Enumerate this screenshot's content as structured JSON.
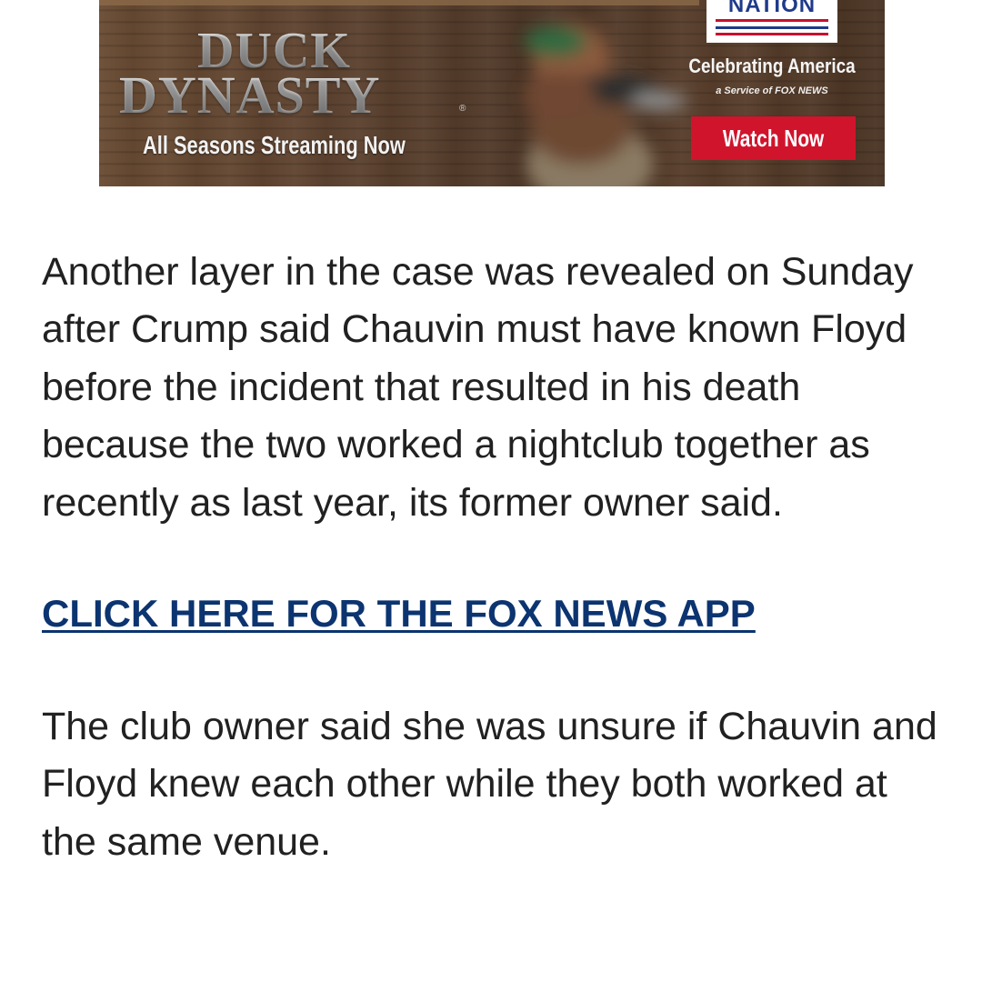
{
  "ad": {
    "title_line1": "DUCK",
    "title_line2": "DYNASTY",
    "trademark": "®",
    "tagline": "All Seasons Streaming Now",
    "logo_text": "NATION",
    "celebrating": "Celebrating America",
    "service": "a Service of FOX NEWS",
    "watch_button": "Watch Now",
    "colors": {
      "button": "#d0142c",
      "logo_blue": "#1f3a8a",
      "wood": "#5e4330"
    },
    "icons": {
      "figure": "blurred-duck-photo"
    }
  },
  "article": {
    "paragraph1": "Another layer in the case was revealed on Sunday after Crump said Chauvin must have known Floyd before the incident that resulted in his death because the two worked a nightclub together as recently as last year, its former owner said.",
    "app_link": "CLICK HERE FOR THE FOX NEWS APP",
    "paragraph2": "The club owner said she was unsure if Chauvin and Floyd knew each other while they both worked at the same venue.",
    "colors": {
      "text": "#212121",
      "link": "#0b3470"
    }
  }
}
